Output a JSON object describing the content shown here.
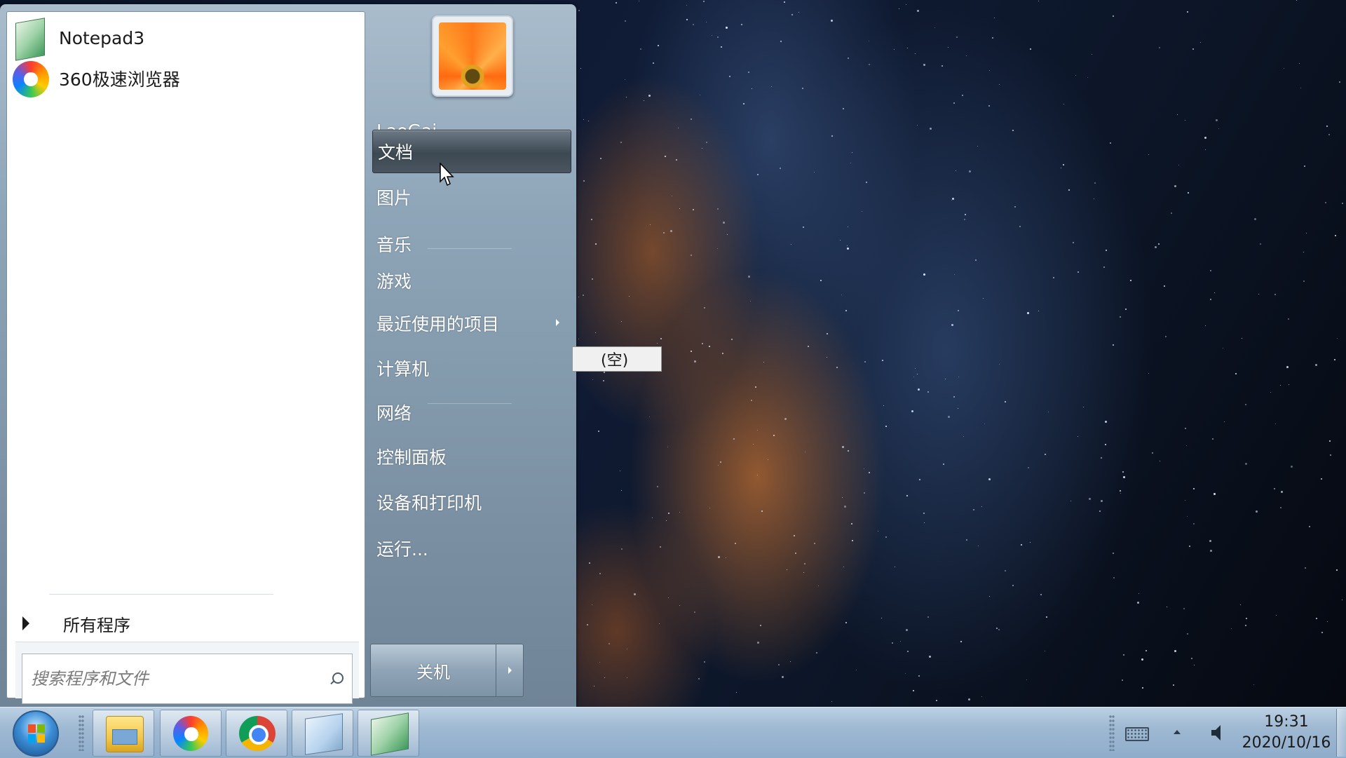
{
  "start_menu": {
    "pinned": [
      {
        "label": "Notepad3",
        "icon": "notepad3-icon"
      },
      {
        "label": "360极速浏览器",
        "icon": "360-browser-icon"
      }
    ],
    "all_programs_label": "所有程序",
    "search": {
      "placeholder": "搜索程序和文件",
      "value": ""
    },
    "user_name": "LaoGai",
    "right_items": [
      "文档",
      "图片",
      "音乐",
      "游戏",
      "最近使用的项目",
      "计算机",
      "网络",
      "控制面板",
      "设备和打印机",
      "运行..."
    ],
    "hovered_item": "文档",
    "shutdown_label": "关机",
    "recent_submenu_item": "(空)"
  },
  "taskbar": {
    "apps": [
      "windows-explorer-icon",
      "360-browser-icon",
      "chrome-icon",
      "notepad-icon",
      "notepad3-icon"
    ],
    "clock": {
      "time": "19:31",
      "date": "2020/10/16"
    }
  },
  "colors": {
    "menu_frame": "#8ea5b8",
    "taskbar": "#9fb9d2",
    "accent_orange": "#ff7a1a"
  }
}
